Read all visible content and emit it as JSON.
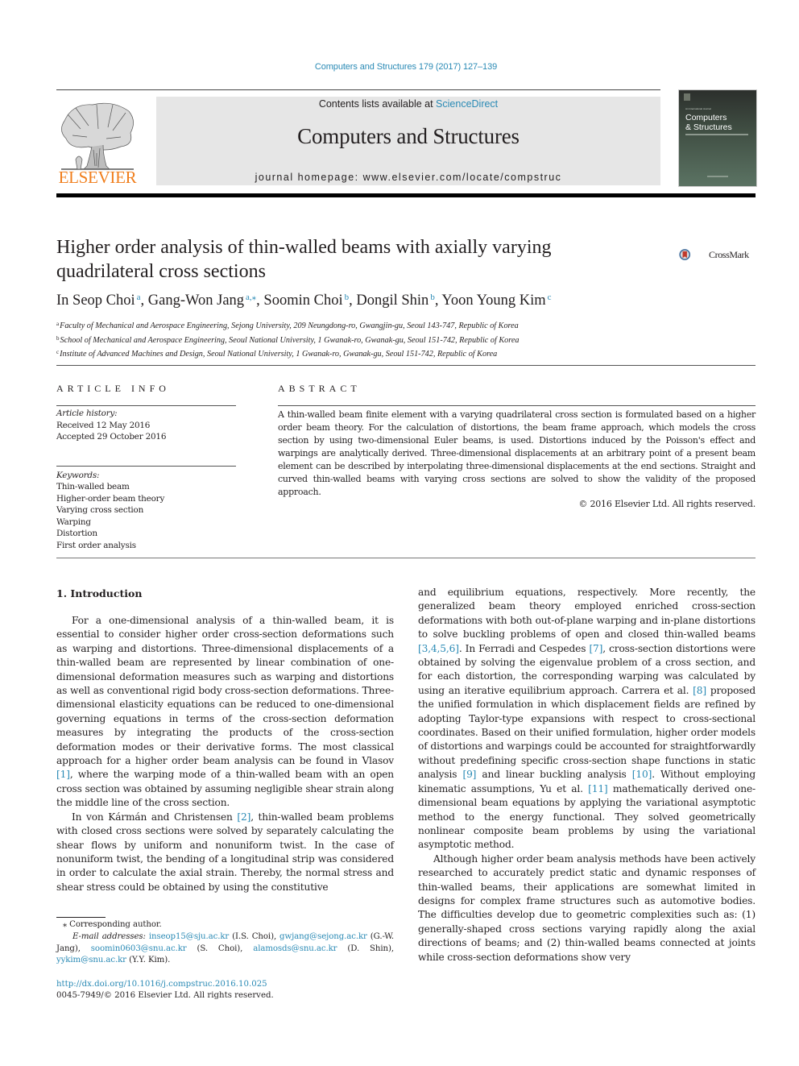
{
  "header": {
    "journal_ref": "Computers and Structures 179 (2017) 127–139",
    "contents_prefix": "Contents lists available at ",
    "contents_link": "ScienceDirect",
    "journal_title": "Computers and Structures",
    "homepage": "journal homepage: www.elsevier.com/locate/compstruc",
    "publisher_logo_text": "ELSEVIER",
    "cover": {
      "small_line": "An International Journal",
      "title_line1": "Computers",
      "title_line2": "& Structures"
    },
    "colors": {
      "link": "#2a8ab5",
      "elsevier_orange": "#f07e1c",
      "banner_bg": "#e6e6e6"
    }
  },
  "article": {
    "title": "Higher order analysis of thin-walled beams with axially varying quadrilateral cross sections",
    "crossmark_label": "CrossMark",
    "authors": [
      {
        "name": "In Seop Choi",
        "sup": "a",
        "sep": ", "
      },
      {
        "name": "Gang-Won Jang",
        "sup": "a,⁎",
        "sep": ", "
      },
      {
        "name": "Soomin Choi",
        "sup": "b",
        "sep": ", "
      },
      {
        "name": "Dongil Shin",
        "sup": "b",
        "sep": ", "
      },
      {
        "name": "Yoon Young Kim",
        "sup": "c",
        "sep": ""
      }
    ],
    "affiliations": [
      {
        "mark": "a",
        "text": "Faculty of Mechanical and Aerospace Engineering, Sejong University, 209 Neungdong-ro, Gwangjin-gu, Seoul 143-747, Republic of Korea"
      },
      {
        "mark": "b",
        "text": "School of Mechanical and Aerospace Engineering, Seoul National University, 1 Gwanak-ro, Gwanak-gu, Seoul 151-742, Republic of Korea"
      },
      {
        "mark": "c",
        "text": "Institute of Advanced Machines and Design, Seoul National University, 1 Gwanak-ro, Gwanak-gu, Seoul 151-742, Republic of Korea"
      }
    ]
  },
  "article_info": {
    "heading": "ARTICLE INFO",
    "history_label": "Article history:",
    "received": "Received 12 May 2016",
    "accepted": "Accepted 29 October 2016",
    "keywords_label": "Keywords:",
    "keywords": [
      "Thin-walled beam",
      "Higher-order beam theory",
      "Varying cross section",
      "Warping",
      "Distortion",
      "First order analysis"
    ]
  },
  "abstract": {
    "heading": "ABSTRACT",
    "text": "A thin-walled beam finite element with a varying quadrilateral cross section is formulated based on a higher order beam theory. For the calculation of distortions, the beam frame approach, which models the cross section by using two-dimensional Euler beams, is used. Distortions induced by the Poisson's effect and warpings are analytically derived. Three-dimensional displacements at an arbitrary point of a present beam element can be described by interpolating three-dimensional displacements at the end sections. Straight and curved thin-walled beams with varying cross sections are solved to show the validity of the proposed approach.",
    "copyright": "© 2016 Elsevier Ltd. All rights reserved."
  },
  "body": {
    "section_heading": "1. Introduction",
    "left_paragraphs": [
      [
        {
          "t": "For a one-dimensional analysis of a thin-walled beam, it is essential to consider higher order cross-section deformations such as warping and distortions. Three-dimensional displacements of a thin-walled beam are represented by linear combination of one-dimensional deformation measures such as warping and distortions as well as conventional rigid body cross-section deformations. Three-dimensional elasticity equations can be reduced to one-dimensional governing equations in terms of the cross-section deformation measures by integrating the products of the cross-section deformation modes or their derivative forms. The most classical approach for a higher order beam analysis can be found in Vlasov "
        },
        {
          "ref": "[1]"
        },
        {
          "t": ", where the warping mode of a thin-walled beam with an open cross section was obtained by assuming negligible shear strain along the middle line of the cross section."
        }
      ],
      [
        {
          "t": "In von Kármán and Christensen "
        },
        {
          "ref": "[2]"
        },
        {
          "t": ", thin-walled beam problems with closed cross sections were solved by separately calculating the shear flows by uniform and nonuniform twist. In the case of nonuniform twist, the bending of a longitudinal strip was considered in order to calculate the axial strain. Thereby, the normal stress and shear stress could be obtained by using the constitutive"
        }
      ]
    ],
    "right_paragraphs": [
      [
        {
          "t": "and equilibrium equations, respectively. More recently, the generalized beam theory employed enriched cross-section deformations with both out-of-plane warping and in-plane distortions to solve buckling problems of open and closed thin-walled beams "
        },
        {
          "ref": "[3,4,5,6]"
        },
        {
          "t": ". In Ferradi and Cespedes "
        },
        {
          "ref": "[7]"
        },
        {
          "t": ", cross-section distortions were obtained by solving the eigenvalue problem of a cross section, and for each distortion, the corresponding warping was calculated by using an iterative equilibrium approach. Carrera et al. "
        },
        {
          "ref": "[8]"
        },
        {
          "t": " proposed the unified formulation in which displacement fields are refined by adopting Taylor-type expansions with respect to cross-sectional coordinates. Based on their unified formulation, higher order models of distortions and warpings could be accounted for straightforwardly without predefining specific cross-section shape functions in static analysis "
        },
        {
          "ref": "[9]"
        },
        {
          "t": " and linear buckling analysis "
        },
        {
          "ref": "[10]"
        },
        {
          "t": ". Without employing kinematic assumptions, Yu et al. "
        },
        {
          "ref": "[11]"
        },
        {
          "t": " mathematically derived one-dimensional beam equations by applying the variational asymptotic method to the energy functional. They solved geometrically nonlinear composite beam problems by using the variational asymptotic method."
        }
      ],
      [
        {
          "t": "Although higher order beam analysis methods have been actively researched to accurately predict static and dynamic responses of thin-walled beams, their applications are somewhat limited in designs for complex frame structures such as automotive bodies. The difficulties develop due to geometric complexities such as: (1) generally-shaped cross sections varying rapidly along the axial directions of beams; and (2) thin-walled beams connected at joints while cross-section deformations show very"
        }
      ]
    ]
  },
  "footnotes": {
    "corresponding": "⁎ Corresponding author.",
    "email_label": "E-mail addresses:",
    "emails": [
      {
        "email": "inseop15@sju.ac.kr",
        "who": " (I.S. Choi), "
      },
      {
        "email": "gwjang@sejong.ac.kr",
        "who": " (G.-W. Jang), "
      },
      {
        "email": "soomin0603@snu.ac.kr",
        "who": " (S. Choi), "
      },
      {
        "email": "alamosds@snu.ac.kr",
        "who": " (D. Shin), "
      },
      {
        "email": "yykim@snu.ac.kr",
        "who": " (Y.Y. Kim)."
      }
    ],
    "doi": "http://dx.doi.org/10.1016/j.compstruc.2016.10.025",
    "issn": "0045-7949/© 2016 Elsevier Ltd. All rights reserved."
  }
}
